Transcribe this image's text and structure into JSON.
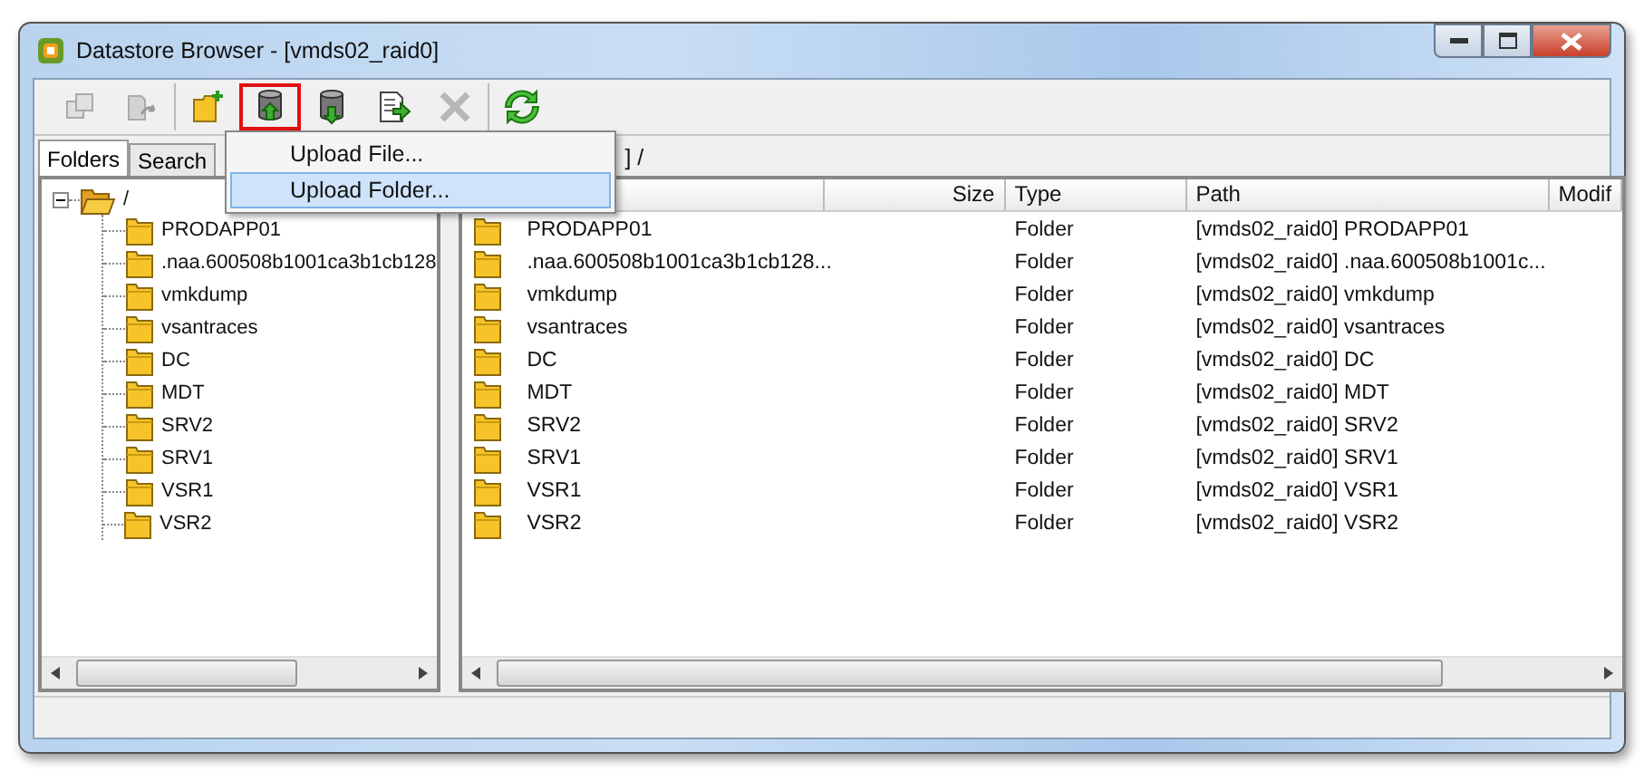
{
  "window": {
    "title": "Datastore Browser - [vmds02_raid0]"
  },
  "toolbar": {
    "groups": [
      [
        {
          "kind": "copy",
          "disabled": true,
          "highlighted": false
        },
        {
          "kind": "move",
          "disabled": true,
          "highlighted": false
        }
      ],
      [
        {
          "kind": "newfolder",
          "disabled": false,
          "highlighted": false
        },
        {
          "kind": "upload",
          "disabled": false,
          "highlighted": true
        },
        {
          "kind": "download",
          "disabled": false,
          "highlighted": false
        },
        {
          "kind": "register",
          "disabled": false,
          "highlighted": false
        },
        {
          "kind": "delete",
          "disabled": true,
          "highlighted": false
        }
      ],
      [
        {
          "kind": "refresh",
          "disabled": false,
          "highlighted": false
        }
      ]
    ]
  },
  "menu": {
    "items": [
      {
        "label": "Upload File...",
        "selected": false
      },
      {
        "label": "Upload Folder...",
        "selected": true
      }
    ]
  },
  "tabs": [
    {
      "label": "Folders",
      "selected": true
    },
    {
      "label": "Search",
      "selected": false
    }
  ],
  "tree": {
    "label": "/",
    "expanded": true,
    "children": [
      {
        "label": "PRODAPP01"
      },
      {
        "label": ".naa.600508b1001ca3b1cb128"
      },
      {
        "label": "vmkdump"
      },
      {
        "label": "vsantraces"
      },
      {
        "label": "DC"
      },
      {
        "label": "MDT"
      },
      {
        "label": "SRV2"
      },
      {
        "label": "SRV1"
      },
      {
        "label": "VSR1"
      },
      {
        "label": "VSR2"
      }
    ]
  },
  "path_bar": "] /",
  "table": {
    "columns": [
      "",
      "Size",
      "Type",
      "Path",
      "Modif"
    ],
    "rows": [
      {
        "name": "PRODAPP01",
        "type": "Folder",
        "path": "[vmds02_raid0] PRODAPP01"
      },
      {
        "name": ".naa.600508b1001ca3b1cb128...",
        "type": "Folder",
        "path": "[vmds02_raid0] .naa.600508b1001c..."
      },
      {
        "name": "vmkdump",
        "type": "Folder",
        "path": "[vmds02_raid0] vmkdump"
      },
      {
        "name": "vsantraces",
        "type": "Folder",
        "path": "[vmds02_raid0] vsantraces"
      },
      {
        "name": "DC",
        "type": "Folder",
        "path": "[vmds02_raid0] DC"
      },
      {
        "name": "MDT",
        "type": "Folder",
        "path": "[vmds02_raid0] MDT"
      },
      {
        "name": "SRV2",
        "type": "Folder",
        "path": "[vmds02_raid0] SRV2"
      },
      {
        "name": "SRV1",
        "type": "Folder",
        "path": "[vmds02_raid0] SRV1"
      },
      {
        "name": "VSR1",
        "type": "Folder",
        "path": "[vmds02_raid0] VSR1"
      },
      {
        "name": "VSR2",
        "type": "Folder",
        "path": "[vmds02_raid0] VSR2"
      }
    ]
  }
}
